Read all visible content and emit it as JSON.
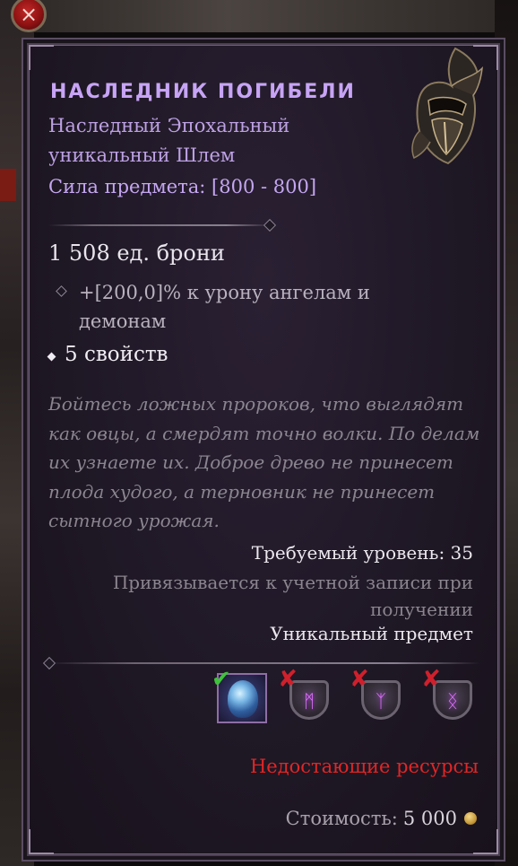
{
  "close_icon": "×",
  "item": {
    "name": "НАСЛЕДНИК ПОГИБЕЛИ",
    "type_line": "Наследный Эпохальный уникальный Шлем",
    "power": "Сила предмета: [800 - 800]",
    "armor": "1 508 ед. брони",
    "affix": "+[200,0]% к урону ангелам и демонам",
    "properties": "5 свойств",
    "flavor": "Бойтесь ложных пророков, что выглядят как овцы, а смердят точно волки. По делам их узнаете их. Доброе древо не принесет плода худого, а терновник не принесет сытного урожая.",
    "required_level": "Требуемый уровень: 35",
    "bind_text": "Привязывается к учетной записи при получении",
    "rarity": "Уникальный предмет"
  },
  "resources": [
    {
      "kind": "gem",
      "status": "ok",
      "icon": "crystal-gem-icon"
    },
    {
      "kind": "rune",
      "status": "missing",
      "glyph": "ᛗ",
      "icon": "rune-shield-icon"
    },
    {
      "kind": "rune",
      "status": "missing",
      "glyph": "ᛉ",
      "icon": "rune-shield-icon"
    },
    {
      "kind": "rune",
      "status": "missing",
      "glyph": "ᛝ",
      "icon": "rune-shield-icon"
    }
  ],
  "missing_resources": "Недостающие ресурсы",
  "cost": {
    "label": "Стоимость:",
    "value": "5 000"
  },
  "colors": {
    "title": "#c7a4f5",
    "missing": "#e02626",
    "ok_mark": "#3ec43a",
    "missing_mark": "#d0202c"
  }
}
